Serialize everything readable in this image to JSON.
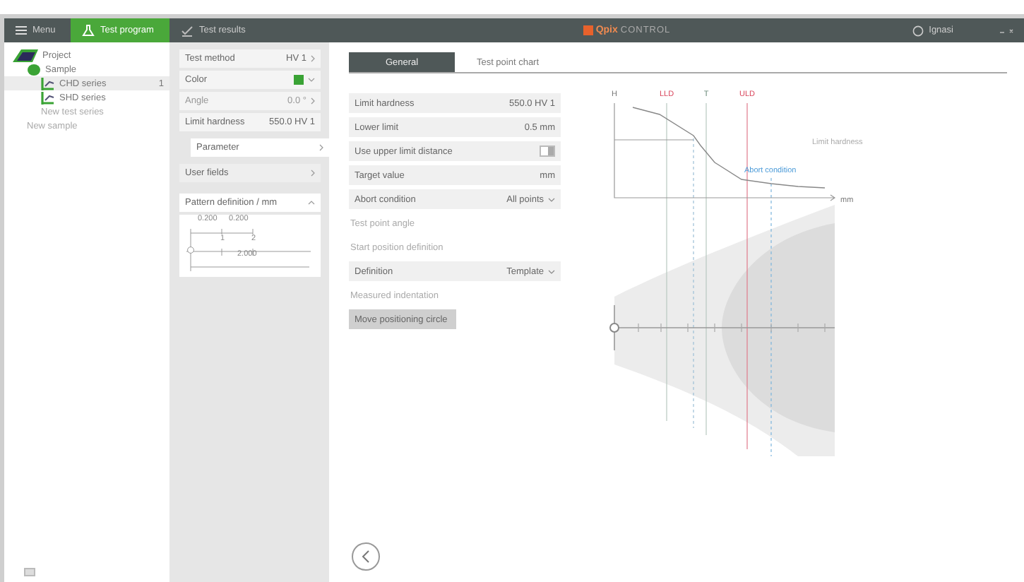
{
  "topbar": {
    "tabs": [
      {
        "label": "Menu",
        "kind": "menu",
        "selected": false
      },
      {
        "label": "Test program",
        "kind": "program",
        "selected": true
      },
      {
        "label": "Test results",
        "kind": "results",
        "selected": false
      }
    ],
    "logo": {
      "brand": "Qpix",
      "product": "CONTROL"
    },
    "user": "Ignasi"
  },
  "tree": [
    {
      "label": "Project",
      "kind": "project",
      "selected": false,
      "disabled": false,
      "children": [
        {
          "label": "Sample",
          "kind": "sample",
          "selected": false,
          "disabled": false,
          "children": [
            {
              "label": "CHD series",
              "kind": "series",
              "selected": true,
              "disabled": false,
              "badge": "1"
            },
            {
              "label": "SHD series",
              "kind": "series",
              "selected": false,
              "disabled": false
            },
            {
              "label": "New test series",
              "kind": "new",
              "selected": false,
              "disabled": true
            }
          ]
        },
        {
          "label": "New sample",
          "kind": "new",
          "selected": false,
          "disabled": true
        }
      ]
    }
  ],
  "params": [
    {
      "label": "Test method",
      "value": "HV 1",
      "kind": "link",
      "disabled": false
    },
    {
      "label": "Color",
      "kind": "color",
      "color": "#3aa335",
      "disabled": false
    },
    {
      "label": "Angle",
      "value": "0.0 °",
      "kind": "link",
      "disabled": true
    },
    {
      "label": "Limit hardness",
      "value": "550.0  HV 1",
      "kind": "value",
      "disabled": false
    }
  ],
  "nav": [
    {
      "label": "Parameter",
      "selected": true
    },
    {
      "label": "User fields",
      "selected": false
    }
  ],
  "pattern": {
    "title": "Pattern definition / mm",
    "expanded": true,
    "spacing_1": "0.200",
    "spacing_2": "0.200",
    "point_1": "1",
    "point_2": "2",
    "length": "2.000"
  },
  "main": {
    "tabs": [
      {
        "label": "General",
        "selected": true
      },
      {
        "label": "Test point chart",
        "selected": false
      }
    ],
    "form": [
      {
        "kind": "value",
        "label": "Limit hardness",
        "value": "550.0  HV 1"
      },
      {
        "kind": "value",
        "label": "Lower limit",
        "value": "0.5  mm"
      },
      {
        "kind": "toggle",
        "label": "Use upper limit distance",
        "on": false
      },
      {
        "kind": "value",
        "label": "Target value",
        "value": "mm"
      },
      {
        "kind": "select",
        "label": "Abort condition",
        "value": "All points"
      },
      {
        "kind": "caption",
        "label": "Test point angle"
      },
      {
        "kind": "caption",
        "label": "Start position definition"
      },
      {
        "kind": "select",
        "label": "Definition",
        "value": "Template"
      },
      {
        "kind": "caption",
        "label": "Measured indentation"
      },
      {
        "kind": "button",
        "label": "Move positioning circle"
      }
    ]
  },
  "diagram": {
    "labels": [
      {
        "text": "H",
        "kind": "axis"
      },
      {
        "text": "LLD",
        "kind": "limit"
      },
      {
        "text": "T",
        "kind": "target"
      },
      {
        "text": "ULD",
        "kind": "limit"
      },
      {
        "text": "Limit hardness",
        "kind": "note"
      },
      {
        "text": "Abort condition",
        "kind": "abort"
      },
      {
        "text": "mm",
        "kind": "axis"
      }
    ]
  }
}
